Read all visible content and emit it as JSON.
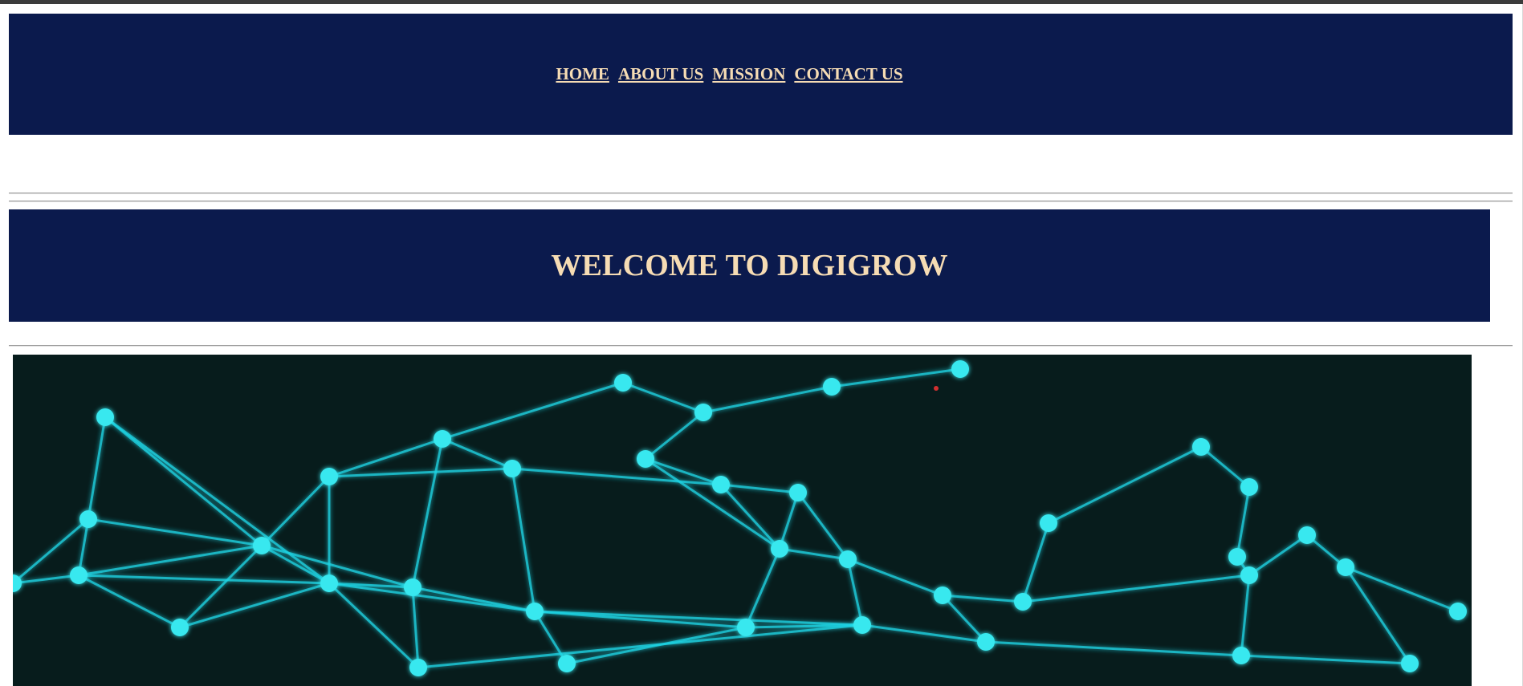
{
  "nav": {
    "items": [
      {
        "label": "HOME"
      },
      {
        "label": "ABOUT US"
      },
      {
        "label": "MISSION"
      },
      {
        "label": "CONTACT US"
      }
    ]
  },
  "welcome": {
    "title": "WELCOME TO DIGIGROW"
  },
  "hero": {
    "image": "network-graph-image"
  },
  "colors": {
    "banner_bg": "#0b1a4d",
    "banner_text": "#f6dcb4",
    "hero_bg": "#071c1c",
    "network_line": "#1fd6e6"
  }
}
